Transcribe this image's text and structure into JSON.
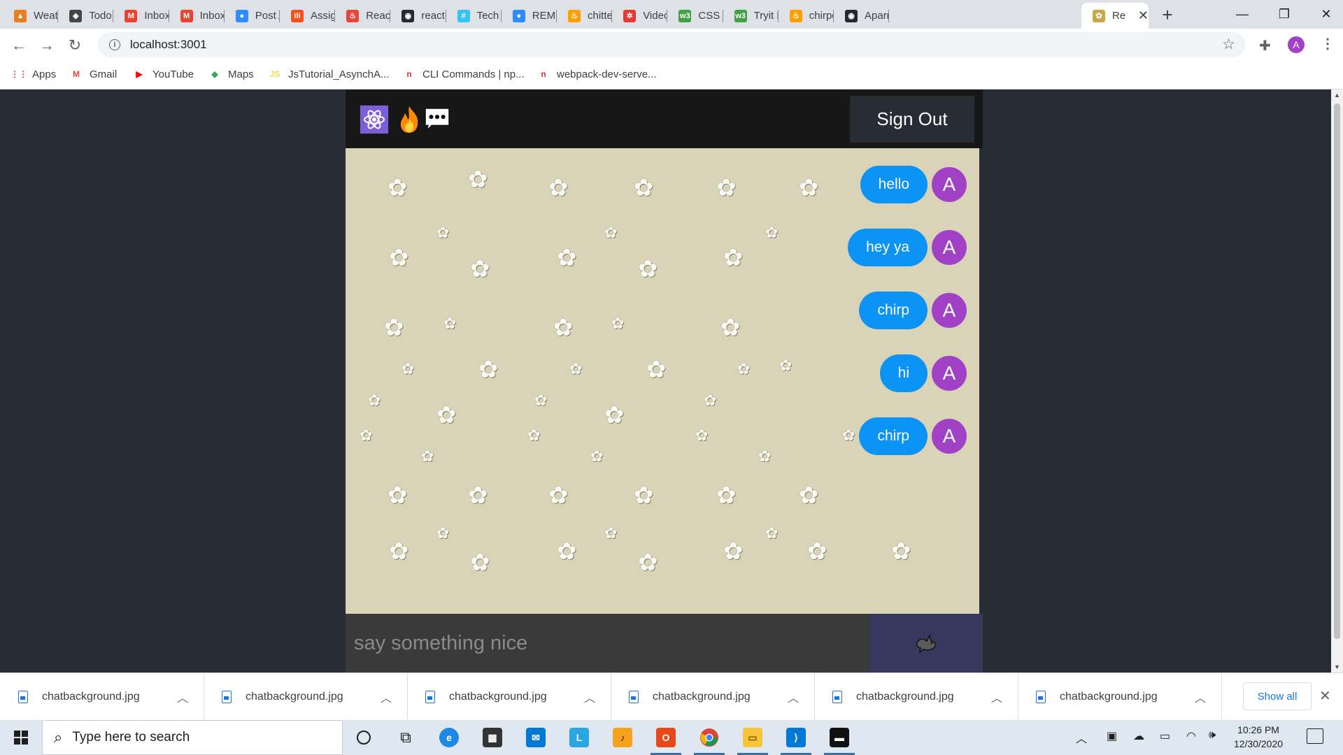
{
  "browser": {
    "tabs": [
      {
        "title": "Weather",
        "color": "#e67e22",
        "glyph": "▲"
      },
      {
        "title": "Todo App",
        "color": "#444444",
        "glyph": "◈"
      },
      {
        "title": "Inbox (",
        "color": "#ea4335",
        "glyph": "M"
      },
      {
        "title": "Inbox (",
        "color": "#ea4335",
        "glyph": "M"
      },
      {
        "title": "Post Au",
        "color": "#2d8cff",
        "glyph": "●"
      },
      {
        "title": "Assign",
        "color": "#f4511e",
        "glyph": "ili"
      },
      {
        "title": "React F",
        "color": "#e8453c",
        "glyph": "♨"
      },
      {
        "title": "react-f",
        "color": "#24292e",
        "glyph": "◉"
      },
      {
        "title": "Tech Ta",
        "color": "#36c5f0",
        "glyph": "#"
      },
      {
        "title": "REMO",
        "color": "#2d8cff",
        "glyph": "●"
      },
      {
        "title": "chitter",
        "color": "#ffa000",
        "glyph": "♨"
      },
      {
        "title": "Video S",
        "color": "#e53935",
        "glyph": "✲"
      },
      {
        "title": "CSS ba",
        "color": "#43a047",
        "glyph": "w3"
      },
      {
        "title": "Tryit Ed",
        "color": "#43a047",
        "glyph": "w3"
      },
      {
        "title": "chirpc",
        "color": "#ffa000",
        "glyph": "♨"
      },
      {
        "title": "Aparna",
        "color": "#24292e",
        "glyph": "◉"
      }
    ],
    "active_tab": {
      "title": "Re",
      "color": "#c9a94a",
      "glyph": "✿"
    },
    "url": "localhost:3001",
    "profile_initial": "A",
    "bookmarks": [
      {
        "label": "Apps",
        "icon": "apps-icon",
        "color": "#ea4335",
        "glyph": "⋮⋮"
      },
      {
        "label": "Gmail",
        "icon": "gmail-icon",
        "color": "#ea4335",
        "glyph": "M"
      },
      {
        "label": "YouTube",
        "icon": "youtube-icon",
        "color": "#ff0000",
        "glyph": "▶"
      },
      {
        "label": "Maps",
        "icon": "maps-icon",
        "color": "#34a853",
        "glyph": "◆"
      },
      {
        "label": "JsTutorial_AsynchA...",
        "icon": "js-icon",
        "color": "#f0db4f",
        "glyph": "JS"
      },
      {
        "label": "CLI Commands | np...",
        "icon": "npm-icon",
        "color": "#cb3837",
        "glyph": "n"
      },
      {
        "label": "webpack-dev-serve...",
        "icon": "npm-icon",
        "color": "#cb3837",
        "glyph": "n"
      }
    ]
  },
  "app": {
    "header": {
      "icons": [
        "react-icon",
        "fire-icon",
        "chat-bubble-icon"
      ],
      "signout_label": "Sign Out"
    },
    "messages": [
      {
        "text": "hello",
        "avatar": "A"
      },
      {
        "text": "hey ya",
        "avatar": "A"
      },
      {
        "text": "chirp",
        "avatar": "A"
      },
      {
        "text": "hi",
        "avatar": "A"
      },
      {
        "text": "chirp",
        "avatar": "A"
      }
    ],
    "input_placeholder": "say something nice",
    "send_icon": "bird-icon",
    "colors": {
      "bubble": "#0b93f6",
      "avatar": "#a142c6",
      "header": "#181717",
      "chat_background": "#d9d3b8",
      "send_button": "#38385f"
    }
  },
  "downloads": {
    "files": [
      "chatbackground.jpg",
      "chatbackground.jpg",
      "chatbackground.jpg",
      "chatbackground.jpg",
      "chatbackground.jpg",
      "chatbackground.jpg"
    ],
    "show_all_label": "Show all"
  },
  "taskbar": {
    "search_placeholder": "Type here to search",
    "time": "10:26 PM",
    "date": "12/30/2020"
  }
}
